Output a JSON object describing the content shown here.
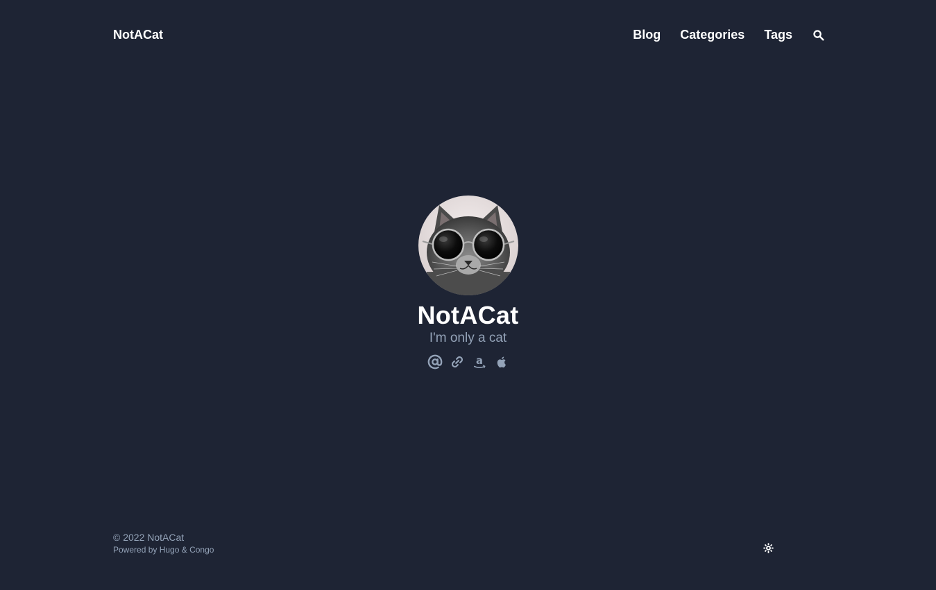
{
  "header": {
    "site_title": "NotACat",
    "nav": [
      {
        "label": "Blog"
      },
      {
        "label": "Categories"
      },
      {
        "label": "Tags"
      }
    ],
    "search_icon": "search-icon"
  },
  "profile": {
    "name": "NotACat",
    "headline": "I'm only a cat",
    "avatar_description": "cat-with-round-sunglasses",
    "links": [
      {
        "icon": "at-email-icon"
      },
      {
        "icon": "link-icon"
      },
      {
        "icon": "amazon-icon"
      },
      {
        "icon": "apple-icon"
      }
    ]
  },
  "footer": {
    "copyright": "© 2022 NotACat",
    "powered_prefix": "Powered by ",
    "hugo": "Hugo",
    "amp": " & ",
    "congo": "Congo",
    "theme_toggle_icon": "sun-icon"
  },
  "colors": {
    "background": "#1e2434",
    "text_primary": "#ffffff",
    "text_muted": "#94a3b8"
  }
}
